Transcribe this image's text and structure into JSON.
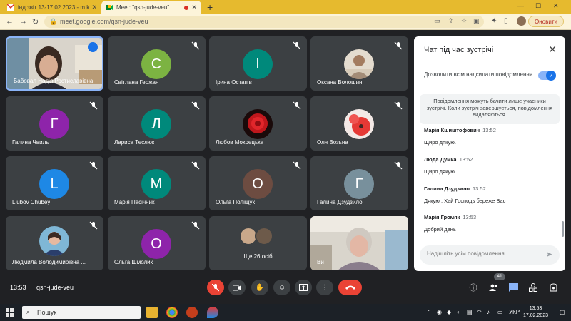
{
  "browser": {
    "tabs": [
      {
        "title": "інд звіт 13-17.02.2023 - m.kondr",
        "active": false
      },
      {
        "title": "Meet: \"qsn-jude-veu\"",
        "active": true
      }
    ],
    "new_tab": "+",
    "url": "meet.google.com/qsn-jude-veu",
    "update_label": "Оновити"
  },
  "participants": [
    {
      "name": "Бабовал Надія Ростиславівна",
      "type": "video",
      "speaking": true
    },
    {
      "name": "Світлана Гержан",
      "initial": "С",
      "color": "#7cb342",
      "muted": true
    },
    {
      "name": "Ірина Остапів",
      "initial": "І",
      "color": "#00897b",
      "muted": true
    },
    {
      "name": "Оксана Волошин",
      "type": "photo",
      "muted": true
    },
    {
      "name": "Галина Чвиль",
      "initial": "Г",
      "color": "#8e24aa",
      "muted": true
    },
    {
      "name": "Лариса Теслюк",
      "initial": "Л",
      "color": "#00897b",
      "muted": true
    },
    {
      "name": "Любов Мокрецька",
      "type": "photo-rose",
      "muted": true
    },
    {
      "name": "Оля Возьна",
      "type": "photo-red",
      "muted": true
    },
    {
      "name": "Liubov Chubey",
      "initial": "L",
      "color": "#1e88e5",
      "muted": true
    },
    {
      "name": "Марія Пасічник",
      "initial": "М",
      "color": "#00897b",
      "muted": true
    },
    {
      "name": "Ольга Поліщук",
      "initial": "О",
      "color": "#6d4c41",
      "muted": true
    },
    {
      "name": "Галина Дзудзило",
      "initial": "Г",
      "color": "#78909c",
      "muted": true
    },
    {
      "name": "Людмила Володимирівна ...",
      "type": "photo-person",
      "muted": true
    },
    {
      "name": "Ольга Шмолик",
      "initial": "О",
      "color": "#8e24aa",
      "muted": true
    },
    {
      "name": "Ще 26 осіб",
      "type": "more"
    },
    {
      "name": "Ви",
      "type": "self-video",
      "muted": true
    }
  ],
  "chat": {
    "title": "Чат під час зустрічі",
    "allow_label": "Дозволити всім надсилати повідомлення",
    "notice": "Повідомлення можуть бачити лише учасники зустрічі. Коли зустріч завершується, повідомлення видаляються.",
    "messages": [
      {
        "author": "Марія Кшиштофович",
        "time": "13:52",
        "text": "Щиро дякую."
      },
      {
        "author": "Люда Думка",
        "time": "13:52",
        "text": "Щиро дякую."
      },
      {
        "author": "Галина Дзудзило",
        "time": "13:52",
        "text": "Дякую . Хай Господь береже Вас"
      },
      {
        "author": "Марія Громяк",
        "time": "13:53",
        "text": "Добрий день"
      }
    ],
    "input_placeholder": "Надішліть усім повідомлення"
  },
  "controls": {
    "time": "13:53",
    "meeting_code": "qsn-jude-veu",
    "participants_count": "41"
  },
  "taskbar": {
    "search_label": "Пошук",
    "language": "УКР",
    "clock_time": "13:53",
    "clock_date": "17.02.2023"
  }
}
